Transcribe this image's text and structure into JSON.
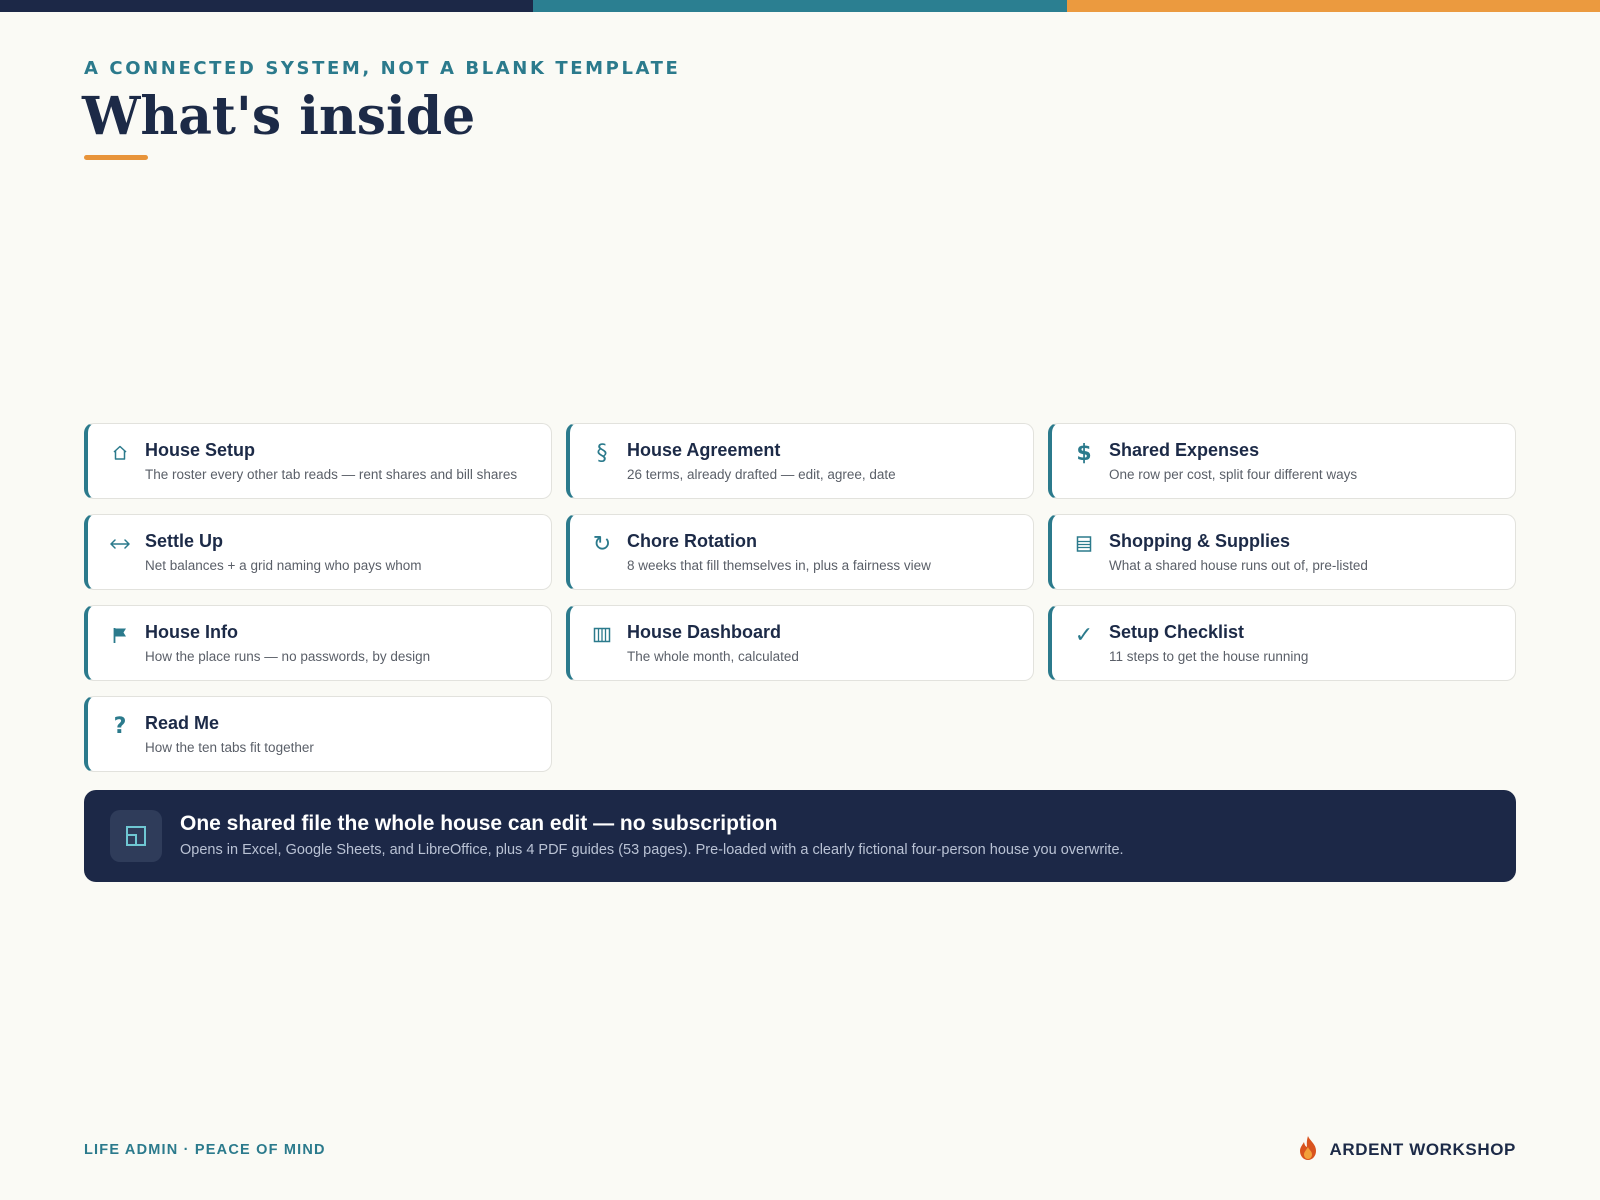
{
  "colors": {
    "navy": "#1c2a47",
    "teal": "#2b7a8c",
    "orange": "#e8943a",
    "background": "#fafaf5"
  },
  "header": {
    "eyebrow": "A CONNECTED SYSTEM, NOT A BLANK TEMPLATE",
    "title": "What's inside"
  },
  "cards": [
    {
      "icon": "house-icon",
      "title": "House Setup",
      "description": "The roster every other tab reads — rent shares and bill shares"
    },
    {
      "icon": "section-icon",
      "title": "House Agreement",
      "description": "26 terms, already drafted — edit, agree, date"
    },
    {
      "icon": "dollar-icon",
      "title": "Shared Expenses",
      "description": "One row per cost, split four different ways"
    },
    {
      "icon": "arrows-icon",
      "title": "Settle Up",
      "description": "Net balances + a grid naming who pays whom"
    },
    {
      "icon": "rotate-icon",
      "title": "Chore Rotation",
      "description": "8 weeks that fill themselves in, plus a fairness view"
    },
    {
      "icon": "list-icon",
      "title": "Shopping & Supplies",
      "description": "What a shared house runs out of, pre-listed"
    },
    {
      "icon": "flag-icon",
      "title": "House Info",
      "description": "How the place runs — no passwords, by design"
    },
    {
      "icon": "columns-icon",
      "title": "House Dashboard",
      "description": "The whole month, calculated"
    },
    {
      "icon": "check-icon",
      "title": "Setup Checklist",
      "description": "11 steps to get the house running"
    },
    {
      "icon": "question-icon",
      "title": "Read Me",
      "description": "How the ten tabs fit together"
    }
  ],
  "banner": {
    "icon": "spreadsheet-icon",
    "title": "One shared file the whole house can edit — no subscription",
    "description": "Opens in Excel, Google Sheets, and LibreOffice, plus 4 PDF guides (53 pages). Pre-loaded with a clearly fictional four-person house you overwrite."
  },
  "footer": {
    "tagline": "LIFE ADMIN · PEACE OF MIND",
    "logo_icon": "flame-logo-icon",
    "brand": "ARDENT WORKSHOP"
  }
}
